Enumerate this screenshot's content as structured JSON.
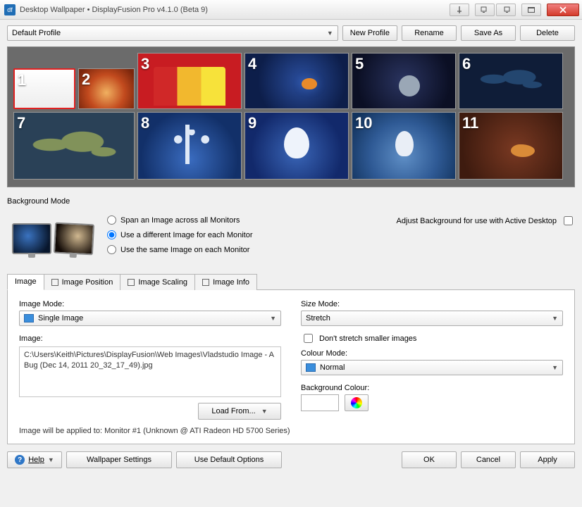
{
  "window": {
    "title": "Desktop Wallpaper • DisplayFusion Pro v4.1.0 (Beta 9)"
  },
  "profile": {
    "selected": "Default Profile",
    "buttons": {
      "new": "New Profile",
      "rename": "Rename",
      "saveas": "Save As",
      "delete": "Delete"
    }
  },
  "monitors": [
    {
      "num": "1"
    },
    {
      "num": "2"
    },
    {
      "num": "3"
    },
    {
      "num": "4"
    },
    {
      "num": "5"
    },
    {
      "num": "6"
    },
    {
      "num": "7"
    },
    {
      "num": "8"
    },
    {
      "num": "9"
    },
    {
      "num": "10"
    },
    {
      "num": "11"
    }
  ],
  "bgmode": {
    "title": "Background Mode",
    "opts": {
      "span": "Span an Image across all Monitors",
      "different": "Use a different Image for each Monitor",
      "same": "Use the same Image on each Monitor"
    },
    "active_desktop": "Adjust Background for use with Active Desktop"
  },
  "tabs": {
    "image": "Image",
    "position": "Image Position",
    "scaling": "Image Scaling",
    "info": "Image Info"
  },
  "imgtab": {
    "imagemode_label": "Image Mode:",
    "imagemode_value": "Single Image",
    "image_label": "Image:",
    "image_path": "C:\\Users\\Keith\\Pictures\\DisplayFusion\\Web Images\\Vladstudio Image - A Bug (Dec 14, 2011 20_32_17_49).jpg",
    "load_from": "Load From...",
    "sizemode_label": "Size Mode:",
    "sizemode_value": "Stretch",
    "dont_stretch": "Don't stretch smaller images",
    "colourmode_label": "Colour Mode:",
    "colourmode_value": "Normal",
    "bgcolour_label": "Background Colour:",
    "applied_to": "Image will be applied to: Monitor #1 (Unknown @ ATI Radeon HD 5700 Series)"
  },
  "bottom": {
    "help": "Help",
    "wallpaper_settings": "Wallpaper Settings",
    "use_default": "Use Default Options",
    "ok": "OK",
    "cancel": "Cancel",
    "apply": "Apply"
  }
}
